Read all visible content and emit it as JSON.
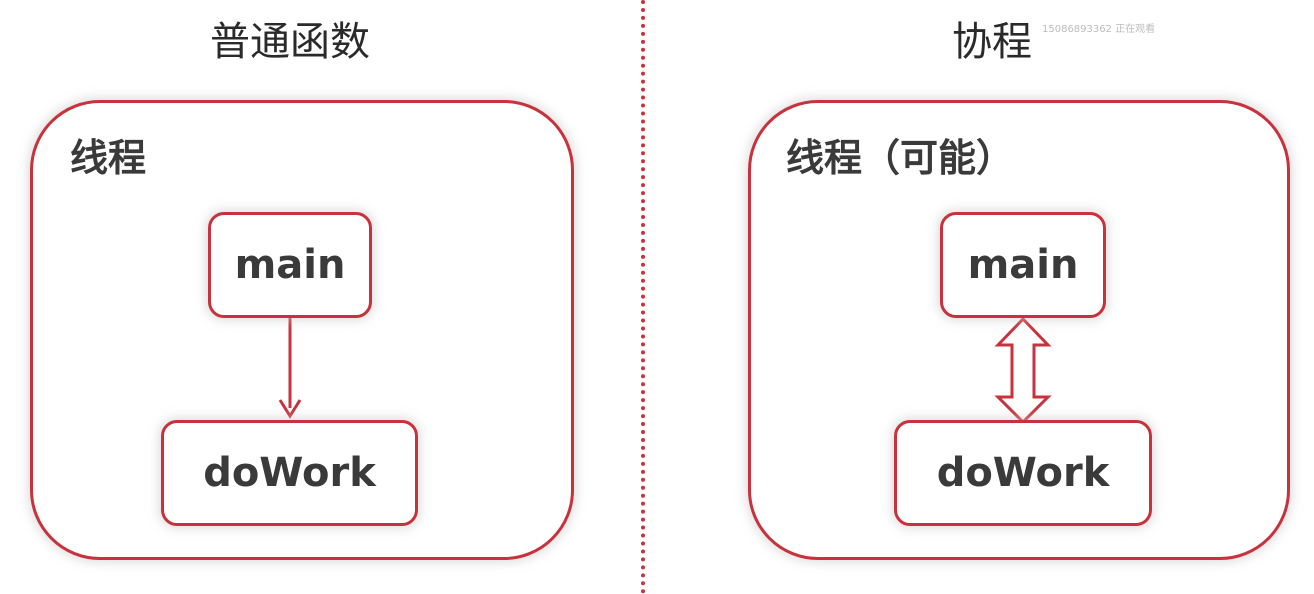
{
  "left_panel": {
    "title": "普通函数",
    "thread_label": "线程",
    "top_function": "main",
    "bottom_function": "doWork"
  },
  "right_panel": {
    "title": "协程",
    "thread_label": "线程（可能）",
    "top_function": "main",
    "bottom_function": "doWork"
  },
  "watermark": "15086893362 正在观看",
  "colors": {
    "accent": "#c8323c",
    "text": "#3a3a3a",
    "background": "#ffffff"
  }
}
